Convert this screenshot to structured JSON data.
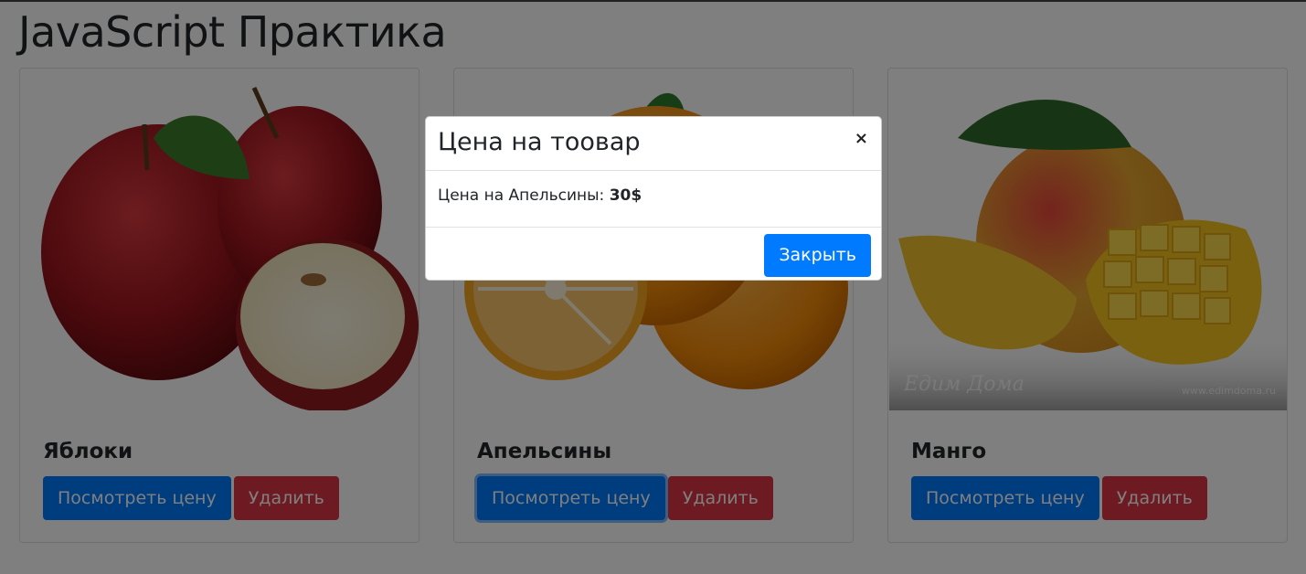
{
  "page": {
    "title": "JavaScript Практика"
  },
  "cards": [
    {
      "title": "Яблоки",
      "view_label": "Посмотреть цену",
      "delete_label": "Удалить"
    },
    {
      "title": "Апельсины",
      "view_label": "Посмотреть цену",
      "delete_label": "Удалить"
    },
    {
      "title": "Манго",
      "view_label": "Посмотреть цену",
      "delete_label": "Удалить"
    }
  ],
  "mango_image": {
    "watermark_text": "Едим Дома",
    "watermark_url": "www.edimdoma.ru"
  },
  "modal": {
    "title": "Цена на тоовар",
    "close_glyph": "×",
    "body_prefix": "Цена на Апельсины: ",
    "price": "30$",
    "close_button": "Закрыть"
  },
  "colors": {
    "primary": "#007bff",
    "danger": "#dc3545",
    "backdrop": "rgba(0,0,0,0.5)"
  }
}
